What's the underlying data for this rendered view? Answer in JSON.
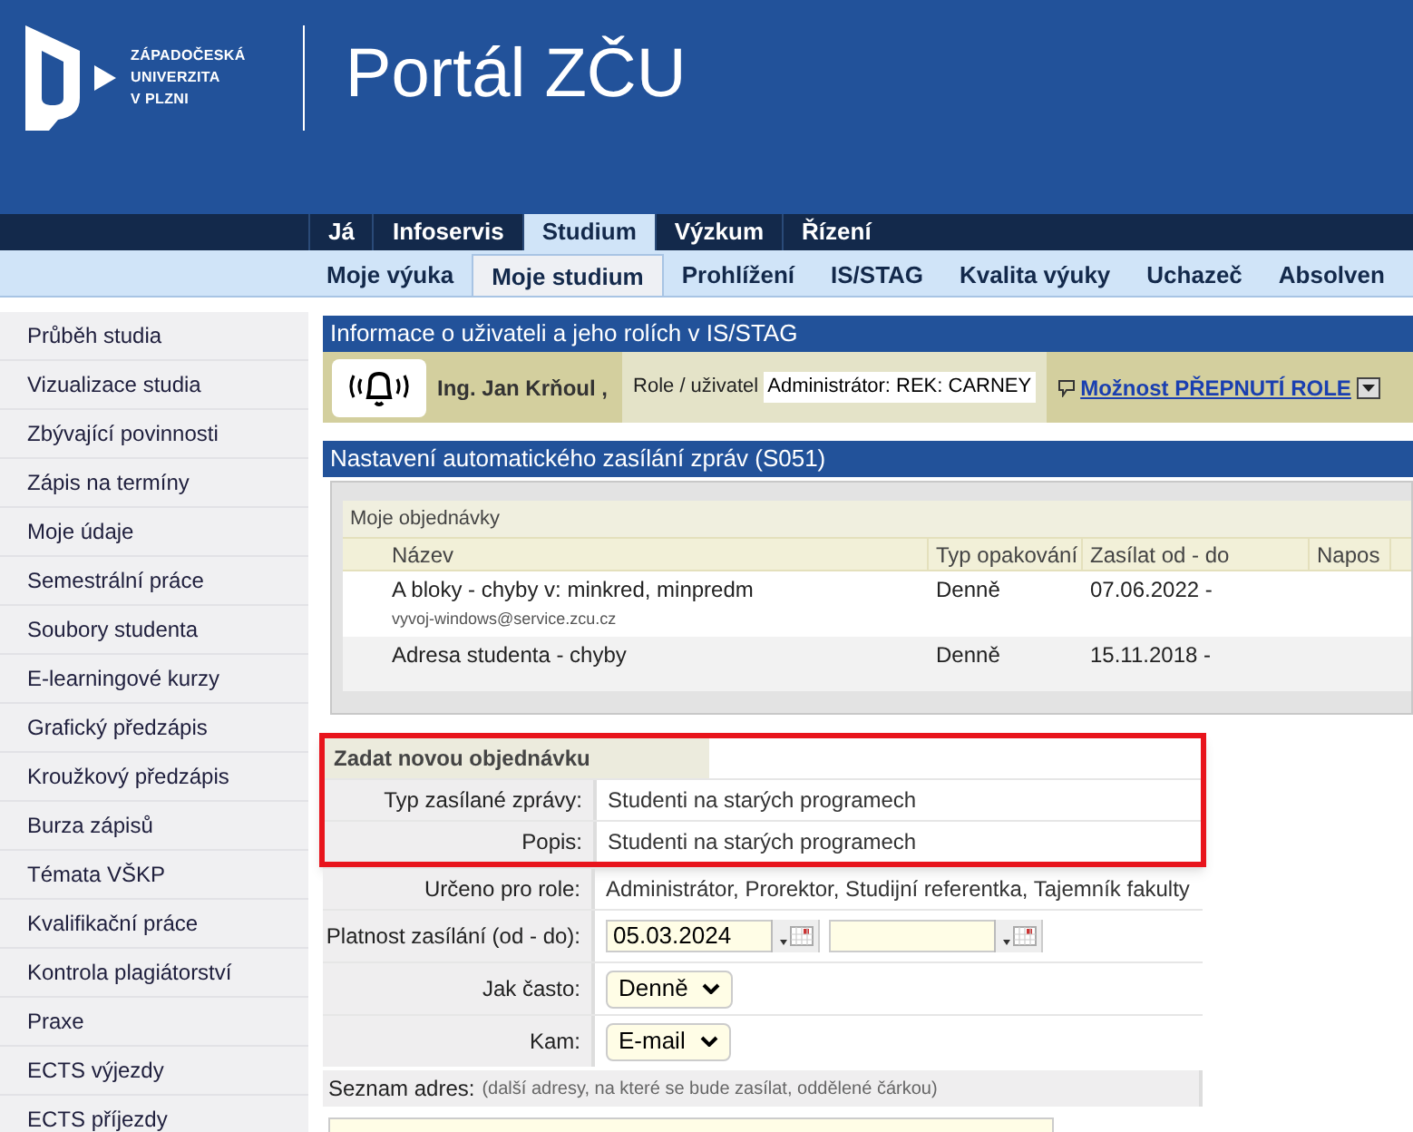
{
  "header": {
    "logo_lines": [
      "ZÁPADOČESKÁ",
      "UNIVERZITA",
      "V PLZNI"
    ],
    "title": "Portál ZČU"
  },
  "top_nav": [
    {
      "label": "Já",
      "selected": false
    },
    {
      "label": "Infoservis",
      "selected": false
    },
    {
      "label": "Studium",
      "selected": true
    },
    {
      "label": "Výzkum",
      "selected": false
    },
    {
      "label": "Řízení",
      "selected": false
    }
  ],
  "sub_nav": [
    {
      "label": "Moje výuka",
      "selected": false
    },
    {
      "label": "Moje studium",
      "selected": true
    },
    {
      "label": "Prohlížení",
      "selected": false
    },
    {
      "label": "IS/STAG",
      "selected": false
    },
    {
      "label": "Kvalita výuky",
      "selected": false
    },
    {
      "label": "Uchazeč",
      "selected": false
    },
    {
      "label": "Absolven",
      "selected": false
    }
  ],
  "sidebar": {
    "items": [
      "Průběh studia",
      "Vizualizace studia",
      "Zbývající povinnosti",
      "Zápis na termíny",
      "Moje údaje",
      "Semestrální práce",
      "Soubory studenta",
      "E-learningové kurzy",
      "Grafický předzápis",
      "Kroužkový předzápis",
      "Burza zápisů",
      "Témata VŠKP",
      "Kvalifikační práce",
      "Kontrola plagiátorství",
      "Praxe",
      "ECTS výjezdy",
      "ECTS příjezdy"
    ]
  },
  "user_info": {
    "title": "Informace o uživateli a jeho rolích v IS/STAG",
    "name": "Ing. Jan Krňoul ,",
    "role_label": "Role / uživatel",
    "role_value": "Administrátor: REK: CARNEY",
    "switch_link": "Možnost PŘEPNUTÍ ROLE"
  },
  "section": {
    "title": "Nastavení automatického zasílání zpráv (S051)",
    "orders": {
      "caption": "Moje objednávky",
      "columns": [
        "Název",
        "Typ opakování",
        "Zasílat od - do",
        "Napos"
      ],
      "rows": [
        {
          "name": "A bloky - chyby v: minkred, minpredm",
          "email": "vyvoj-windows@service.zcu.cz",
          "repeat": "Denně",
          "from": "07.06.2022 -"
        },
        {
          "name": "Adresa studenta - chyby",
          "repeat": "Denně",
          "from": "15.11.2018 -"
        }
      ]
    },
    "form": {
      "title": "Zadat novou objednávku",
      "highlighted": true,
      "fields": [
        {
          "kind": "text",
          "label": "Typ zasílané zprávy:",
          "value": "Studenti na starých programech"
        },
        {
          "kind": "text",
          "label": "Popis:",
          "value": "Studenti na starých programech"
        },
        {
          "kind": "text",
          "label": "Určeno pro role:",
          "value": "Administrátor, Prorektor, Studijní referentka, Tajemník fakulty"
        },
        {
          "kind": "dates",
          "label": "Platnost zasílání (od - do):",
          "from": "05.03.2024"
        },
        {
          "kind": "select",
          "label": "Jak často:",
          "value": "Denně"
        },
        {
          "kind": "select",
          "label": "Kam:",
          "value": "E-mail"
        }
      ],
      "addresses_label": "Seznam adres:",
      "addresses_hint": "(další adresy, na které se bude zasílat, oddělené čárkou)"
    }
  }
}
